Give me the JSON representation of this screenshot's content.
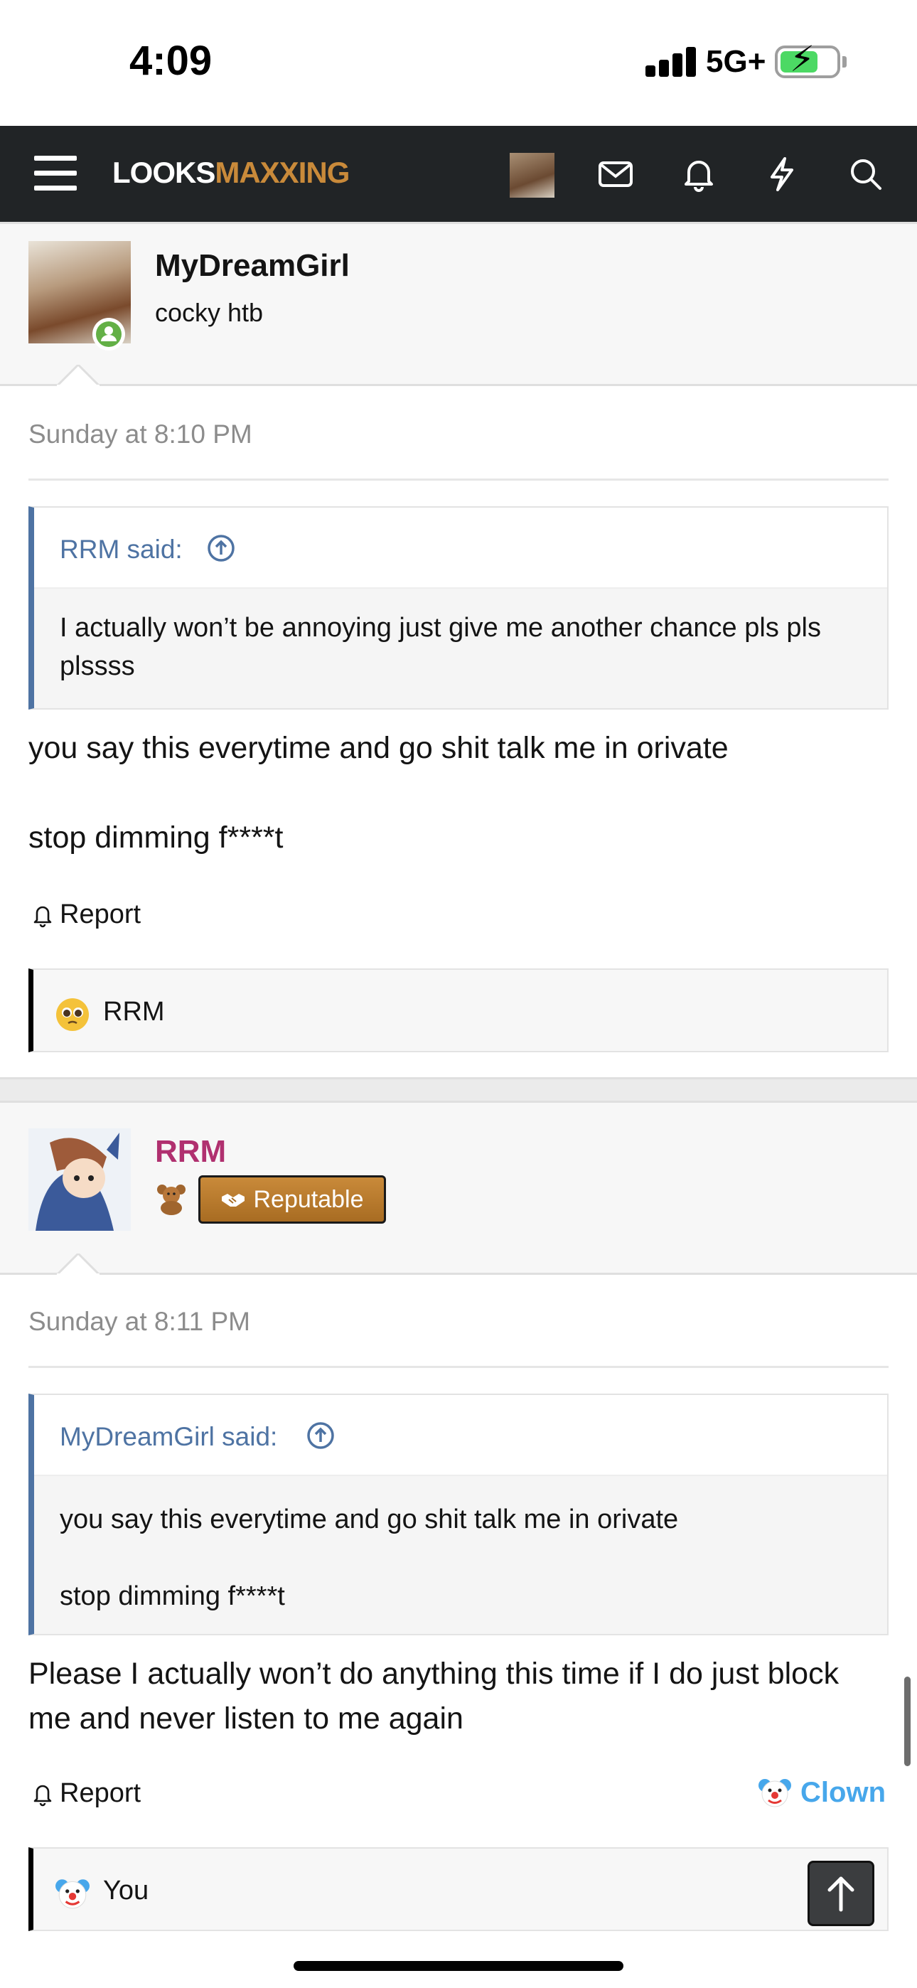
{
  "status_bar": {
    "time": "4:09",
    "network": "5G+"
  },
  "nav": {
    "logo_part1": "LOOKS",
    "logo_part2": "MAXXING"
  },
  "posts": [
    {
      "username": "MyDreamGirl",
      "user_title": "cocky htb",
      "date": "Sunday at 8:10 PM",
      "quote_author": "RRM said:",
      "quote_text": "I actually won’t be annoying just give me another chance pls pls plssss",
      "message_line1": "you say this everytime and go shit talk me in orivate",
      "message_line2": "stop dimming f****t",
      "report_label": "Report",
      "reaction_user": "RRM"
    },
    {
      "username": "RRM",
      "badge": "Reputable",
      "date": "Sunday at 8:11 PM",
      "quote_author": "MyDreamGirl said:",
      "quote_line1": "you say this everytime and go shit talk me in orivate",
      "quote_line2": "stop dimming f****t",
      "message": "Please I actually won’t do anything this time if I do just block me and never listen to me again",
      "report_label": "Report",
      "reaction_button": "Clown",
      "reaction_user": "You"
    }
  ],
  "colors": {
    "nav_bg": "#212426",
    "brand_gold": "#c98a3a",
    "link_blue": "#47a7eb",
    "username_pink": "#b0306f",
    "quote_blue": "#4e73a3"
  }
}
